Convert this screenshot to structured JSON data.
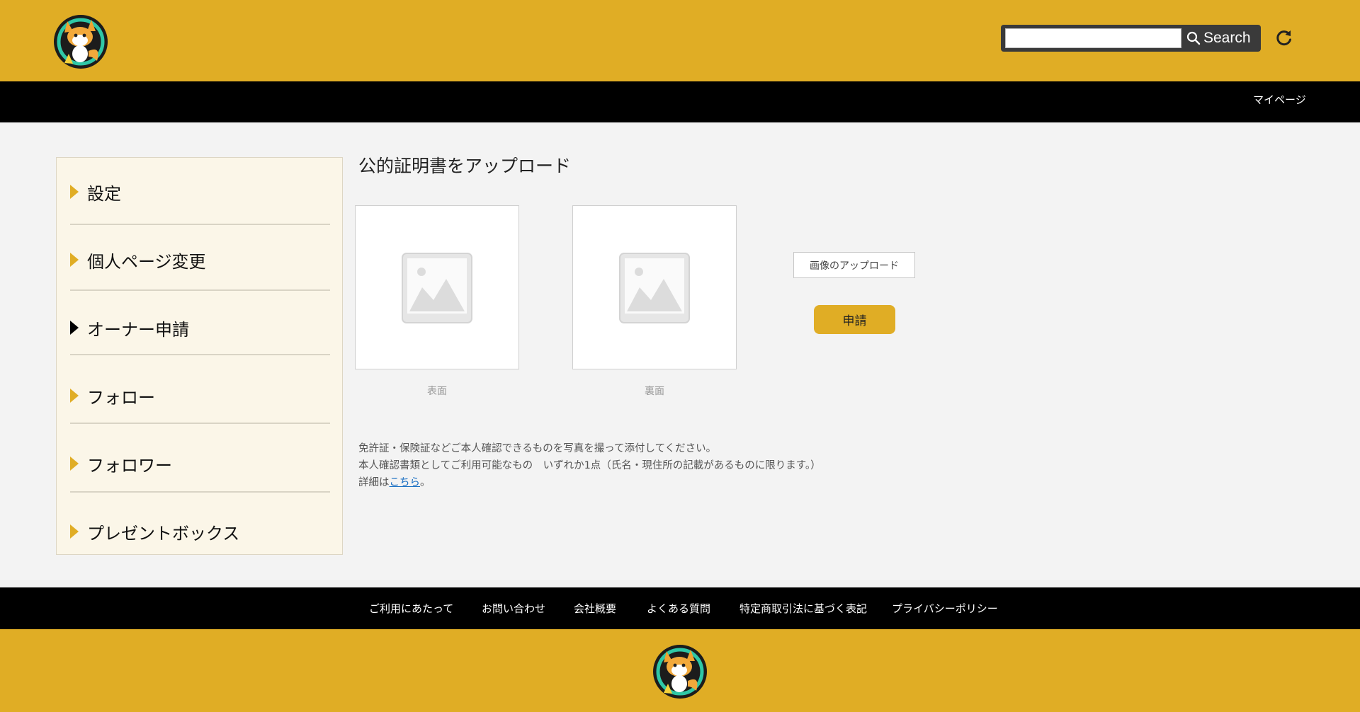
{
  "header": {
    "logo": "fox-mascot-logo",
    "search": {
      "placeholder": "",
      "button_label": "Search"
    },
    "refresh_icon": "refresh-icon"
  },
  "navbar": {
    "mypage_label": "マイページ"
  },
  "sidebar": {
    "items": [
      {
        "label": "設定",
        "active": false
      },
      {
        "label": "個人ページ変更",
        "active": false
      },
      {
        "label": "オーナー申請",
        "active": true
      },
      {
        "label": "フォロー",
        "active": false
      },
      {
        "label": "フォロワー",
        "active": false
      },
      {
        "label": "プレゼントボックス",
        "active": false
      }
    ]
  },
  "main": {
    "title": "公的証明書をアップロード",
    "images": [
      {
        "caption": "表面"
      },
      {
        "caption": "裏面"
      }
    ],
    "upload_label": "画像のアップロード",
    "apply_label": "申請",
    "notes": {
      "line1": "免許証・保険証などご本人確認できるものを写真を撮って添付してください。",
      "line2": "本人確認書類としてご利用可能なもの　いずれか1点（氏名・現住所の記載があるものに限ります。）",
      "line3_prefix": "詳細は",
      "line3_link": "こちら",
      "line3_suffix": "。"
    }
  },
  "footer": {
    "links": [
      "ご利用にあたって",
      "お問い合わせ",
      "会社概要",
      "よくある質問",
      "特定商取引法に基づく表記",
      "プライバシーポリシー"
    ],
    "logo": "fox-mascot-logo"
  },
  "colors": {
    "brand_yellow": "#e0ad25",
    "nav_black": "#000000",
    "sidebar_bg": "#fbf6e8",
    "page_bg": "#f3f3f3",
    "link_blue": "#1a6fc3"
  }
}
